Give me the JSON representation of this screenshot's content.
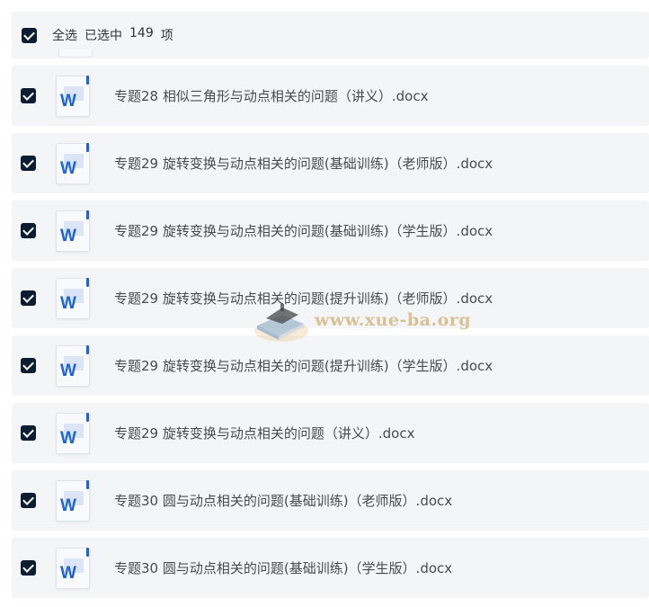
{
  "header": {
    "select_all": "全选",
    "selected_prefix": "已选中",
    "selected_count": "149",
    "selected_suffix": "项"
  },
  "file_icon_letter": "W",
  "files": [
    {
      "name": "专题28 相似三角形与动点相关的问题（讲义）.docx"
    },
    {
      "name": "专题29 旋转变换与动点相关的问题(基础训练)（老师版）.docx"
    },
    {
      "name": "专题29 旋转变换与动点相关的问题(基础训练)（学生版）.docx"
    },
    {
      "name": "专题29 旋转变换与动点相关的问题(提升训练)（老师版）.docx"
    },
    {
      "name": "专题29 旋转变换与动点相关的问题(提升训练)（学生版）.docx"
    },
    {
      "name": "专题29 旋转变换与动点相关的问题（讲义）.docx"
    },
    {
      "name": "专题30 圆与动点相关的问题(基础训练)（老师版）.docx"
    },
    {
      "name": "专题30 圆与动点相关的问题(基础训练)（学生版）.docx"
    }
  ],
  "watermark": {
    "text": "www.xue-ba.org"
  },
  "colors": {
    "checkbox": "#0b1d33",
    "row_background": "#f4f5f7",
    "word_blue": "#1c63d6"
  }
}
